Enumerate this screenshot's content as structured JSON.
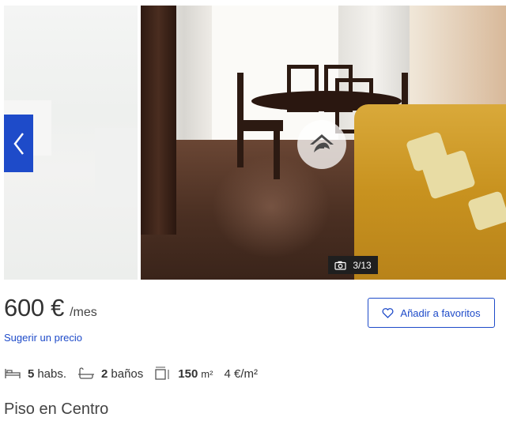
{
  "gallery": {
    "counter": "3/13",
    "prev_icon": "chevron-left-icon",
    "camera_icon": "camera-icon",
    "watermark_icon": "house-logo-icon"
  },
  "price": {
    "amount": "600 €",
    "period": "/mes",
    "suggest_link": "Sugerir un precio"
  },
  "favorite": {
    "label": "Añadir a favoritos",
    "icon": "heart-icon"
  },
  "features": {
    "rooms_value": "5",
    "rooms_label": "habs.",
    "baths_value": "2",
    "baths_label": "baños",
    "area_value": "150",
    "area_unit": "m²",
    "price_per_m2": "4 €/m²"
  },
  "listing": {
    "title": "Piso en Centro"
  },
  "colors": {
    "accent": "#1e4bc9",
    "badge_bg": "#1f1f1f",
    "text": "#333333"
  }
}
